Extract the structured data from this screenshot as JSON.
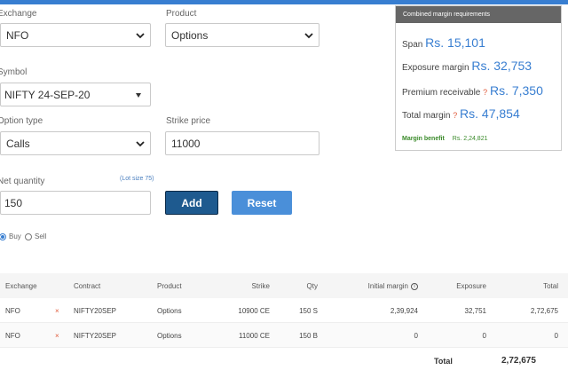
{
  "form": {
    "exchange": {
      "label": "Exchange",
      "value": "NFO"
    },
    "product": {
      "label": "Product",
      "value": "Options"
    },
    "symbol": {
      "label": "Symbol",
      "value": "NIFTY 24-SEP-20"
    },
    "option_type": {
      "label": "Option type",
      "value": "Calls"
    },
    "strike_price": {
      "label": "Strike price",
      "value": "11000"
    },
    "net_quantity": {
      "label": "Net quantity",
      "value": "150",
      "lot_size": "(Lot size 75)"
    },
    "add_label": "Add",
    "reset_label": "Reset",
    "buy_label": "Buy",
    "sell_label": "Sell",
    "side_selected": "Buy"
  },
  "margins": {
    "title": "Combined margin requirements",
    "span": {
      "label": "Span",
      "value": "Rs. 15,101"
    },
    "exposure": {
      "label": "Exposure margin",
      "value": "Rs. 32,753"
    },
    "premium": {
      "label": "Premium receivable",
      "q": "?",
      "value": "Rs. 7,350"
    },
    "total": {
      "label": "Total margin",
      "q": "?",
      "value": "Rs. 47,854"
    },
    "benefit": {
      "label": "Margin benefit",
      "value": "Rs. 2,24,821"
    }
  },
  "table": {
    "headers": {
      "exchange": "Exchange",
      "contract": "Contract",
      "product": "Product",
      "strike": "Strike",
      "qty": "Qty",
      "initial_margin": "Initial margin",
      "exposure": "Exposure",
      "total": "Total"
    },
    "info_icon": "i",
    "rows": [
      {
        "exchange": "NFO",
        "remove": "×",
        "contract": "NIFTY20SEP",
        "product": "Options",
        "strike": "10900 CE",
        "qty": "150 S",
        "initial_margin": "2,39,924",
        "exposure": "32,751",
        "total": "2,72,675"
      },
      {
        "exchange": "NFO",
        "remove": "×",
        "contract": "NIFTY20SEP",
        "product": "Options",
        "strike": "11000 CE",
        "qty": "150 B",
        "initial_margin": "0",
        "exposure": "0",
        "total": "0"
      }
    ],
    "footer": {
      "label": "Total",
      "value": "2,72,675"
    }
  },
  "colors": {
    "accent": "#387ed1",
    "add_button": "#1e5a8f",
    "reset_button": "#4a8fd9",
    "remove": "#e05a3a",
    "benefit": "#3a8a2a"
  }
}
